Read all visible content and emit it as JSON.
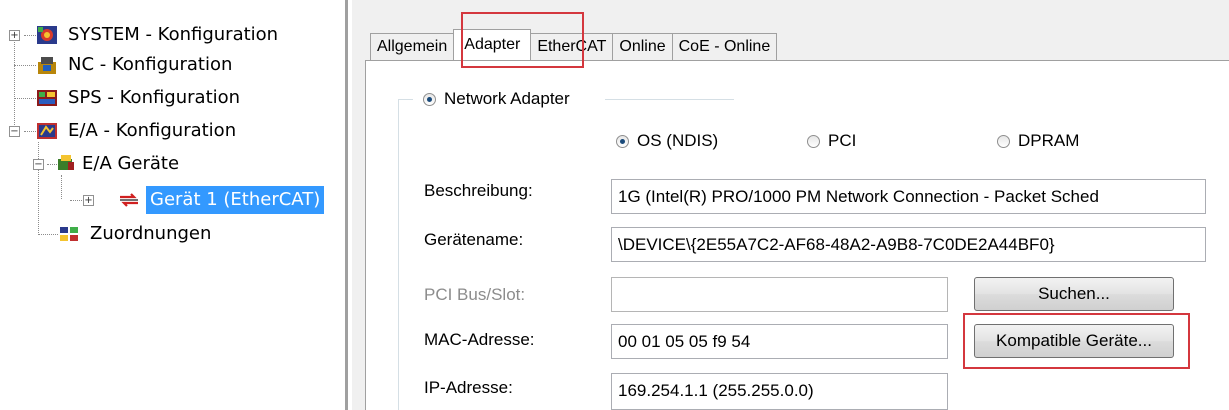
{
  "tree": {
    "items": [
      {
        "label": "SYSTEM - Konfiguration"
      },
      {
        "label": "NC - Konfiguration"
      },
      {
        "label": "SPS - Konfiguration"
      },
      {
        "label": "E/A - Konfiguration"
      },
      {
        "label": "E/A Geräte"
      },
      {
        "label": "Gerät 1 (EtherCAT)"
      },
      {
        "label": "Zuordnungen"
      }
    ]
  },
  "tabs": [
    {
      "label": "Allgemein"
    },
    {
      "label": "Adapter"
    },
    {
      "label": "EtherCAT"
    },
    {
      "label": "Online"
    },
    {
      "label": "CoE - Online"
    }
  ],
  "adapter": {
    "group_radio": "Network Adapter",
    "options": [
      "OS (NDIS)",
      "PCI",
      "DPRAM"
    ],
    "selected_option": "OS (NDIS)",
    "fields": {
      "beschreibung": {
        "label": "Beschreibung:",
        "value": "1G (Intel(R) PRO/1000 PM Network Connection - Packet Sched"
      },
      "geraetename": {
        "label": "Gerätename:",
        "value": "\\DEVICE\\{2E55A7C2-AF68-48A2-A9B8-7C0DE2A44BF0}"
      },
      "pci": {
        "label": "PCI Bus/Slot:",
        "value": ""
      },
      "mac": {
        "label": "MAC-Adresse:",
        "value": "00 01 05 05 f9 54"
      },
      "ip": {
        "label": "IP-Adresse:",
        "value": "169.254.1.1 (255.255.0.0)"
      }
    },
    "buttons": {
      "suchen": "Suchen...",
      "kompatible": "Kompatible Geräte..."
    }
  },
  "colors": {
    "selection": "#3399ff",
    "highlight": "#d4373e"
  }
}
